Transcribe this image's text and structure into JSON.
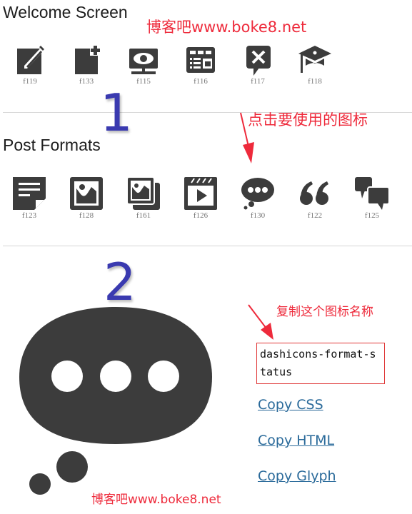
{
  "sections": {
    "welcome": {
      "title": "Welcome Screen",
      "icons": [
        {
          "name": "welcome-write-blog",
          "code": "f119"
        },
        {
          "name": "welcome-add-page",
          "code": "f133"
        },
        {
          "name": "welcome-view-site",
          "code": "f115"
        },
        {
          "name": "welcome-widgets-menus",
          "code": "f116"
        },
        {
          "name": "welcome-comments",
          "code": "f117"
        },
        {
          "name": "welcome-learn-more",
          "code": "f118"
        }
      ]
    },
    "post_formats": {
      "title": "Post Formats",
      "icons": [
        {
          "name": "format-aside",
          "code": "f123"
        },
        {
          "name": "format-image",
          "code": "f128"
        },
        {
          "name": "format-gallery",
          "code": "f161"
        },
        {
          "name": "format-video",
          "code": "f126"
        },
        {
          "name": "format-status",
          "code": "f130"
        },
        {
          "name": "format-quote",
          "code": "f122"
        },
        {
          "name": "format-chat",
          "code": "f125"
        }
      ]
    }
  },
  "annotations": {
    "watermark_top": "博客吧www.boke8.net",
    "watermark_bottom": "博客吧www.boke8.net",
    "step1_number": "1",
    "step1_hint": "点击要使用的图标",
    "step2_number": "2",
    "step2_hint": "复制这个图标名称"
  },
  "detail": {
    "selected_icon": "format-status",
    "icon_class_name": "dashicons-format-status",
    "links": {
      "copy_css": "Copy CSS",
      "copy_html": "Copy HTML",
      "copy_glyph": "Copy Glyph"
    }
  },
  "colors": {
    "icon": "#3c3c3c",
    "annotation_red": "#ee2a3b",
    "step_number_blue": "#3a3ab0",
    "link": "#2a6a9a"
  }
}
